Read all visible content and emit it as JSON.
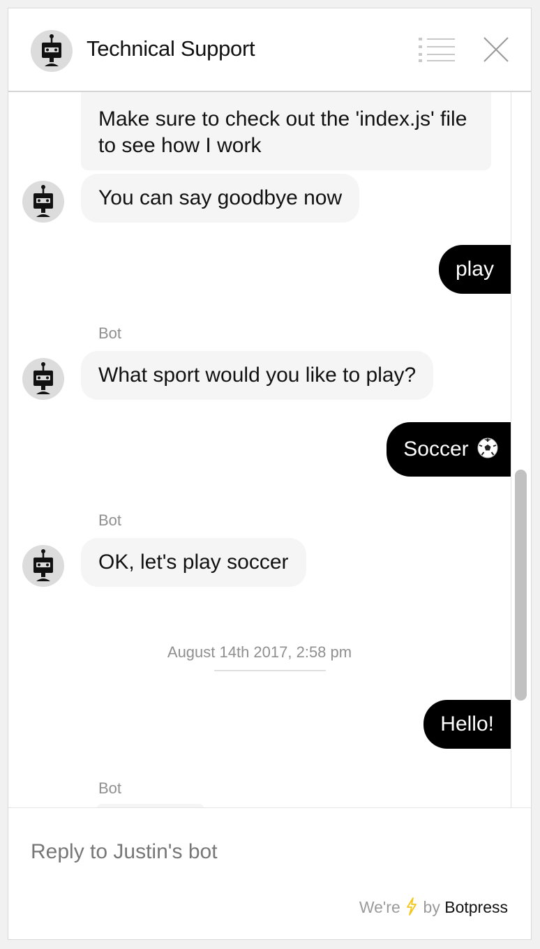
{
  "header": {
    "title": "Technical Support",
    "avatar_icon": "robot-icon",
    "menu_icon": "list-icon",
    "close_icon": "close-icon"
  },
  "messages": [
    {
      "from": "bot",
      "text": "Make sure to check out the 'index.js' file to see how I work"
    },
    {
      "from": "bot",
      "text": "You can say goodbye now"
    },
    {
      "from": "user",
      "text": "play"
    },
    {
      "from": "bot",
      "sender": "Bot",
      "text": "What sport would you like to play?"
    },
    {
      "from": "user",
      "text": "Soccer",
      "emoji_icon": "soccer-ball-icon"
    },
    {
      "from": "bot",
      "sender": "Bot",
      "text": "OK, let's play soccer"
    },
    {
      "type": "timestamp",
      "text": "August 14th 2017, 2:58 pm"
    },
    {
      "from": "user",
      "text": "Hello!"
    },
    {
      "from": "bot",
      "sender": "Bot",
      "text": ""
    }
  ],
  "composer": {
    "placeholder": "Reply to Justin's bot",
    "value": ""
  },
  "footer": {
    "powered_prefix": "We're",
    "powered_icon": "lightning-bolt-icon",
    "powered_by": "by",
    "brand": "Botpress"
  },
  "colors": {
    "user_bubble": "#000000",
    "bot_bubble": "#f5f5f5",
    "bolt": "#f5c518",
    "muted_text": "#8f8f8f"
  }
}
